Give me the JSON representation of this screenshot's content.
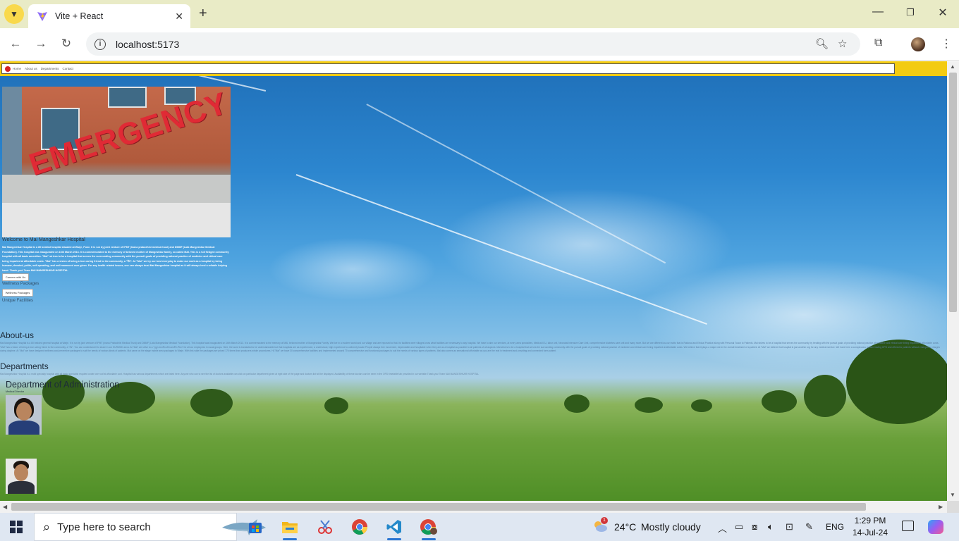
{
  "browser": {
    "tab_title": "Vite + React",
    "url": "localhost:5173",
    "icons": [
      "tab-menu-icon",
      "vite-icon",
      "close-icon",
      "plus-icon",
      "back-icon",
      "forward-icon",
      "reload-icon",
      "site-info-icon",
      "zoom-icon",
      "star-icon",
      "extensions-icon",
      "profile-icon",
      "kebab-menu-icon",
      "minimize-icon",
      "restore-icon",
      "window-close-icon"
    ]
  },
  "page": {
    "navbar": {
      "links": [
        "Home",
        "About us",
        "Departments",
        "Contact"
      ]
    },
    "hero": {
      "sign_text": "EMERGENCY"
    },
    "welcome_title": "Welcome to Mai Mangeshkar Hospital",
    "intro_text": "Mai Mangeshkar Hospital is a 80 bedded hospital situated at Warje, Pune. It is run by joint venture of IPMT (Inana prabodhini medical trust) and DMMF (Lata Mangeshkar Medical Foundation). This hospital was inaugurated on 16th March 2013. It is commemorated to the memory of beloved mother of Mangeshkar family, so called MAI. This is a full fledged community hospital with all basic amenities. \"Mai\" strives to be a hospital that serves the surrounding community with the pursuit goals of providing rational practice of medicine and ethical care being imparted at affordable costs. \"Mai\" has a vision of being a true caring friend to the community, a \"मैत्र\". At \"Mai\" we try our best everyday to make our work as a hospital by being humane, devoted, polite, soft-speaking, and well mannered user given. For any health related issues, one can always trust Mai Mangeshkar hospital as it will always lend a reliable helping hand. Thank you! Team MAI MANGESHKAR HOSPITAL",
    "careers_button": "Careers with Us",
    "wellness_label": "Wellness Packages",
    "wellness_button": "Wellness Packages",
    "facilities_label": "Unique Facilities",
    "about": {
      "heading": "About-us",
      "text": "Mai Mangeshkar Hospital is a 80 bedded general hospital at Warje. It is run by joint venture of IPMT (Inana Prabodhini Medical Trust) and DMMF (Lata Mangeshkar Medical Foundation). This hospital was inaugurated on 16th March 2013. It is commemorated to the memory of MAI, beloved mother of Mangeshkar Family. We live in a modern world and our village and are exposed to that. Its facilities were villages know what facilities are necessary to any hospital. We have to aim our services, at every area specialties, Medical ICU, labor unit, Neonatal Intensive Care Unit, comprehensive diabetes care unit and many more. But we are different as our motto that is Rational and Ethical Practice along with Personal Touch to Patients. Mai strives to be a hospital that serves the community by treating with the pursuit goals of providing rational practice of medicine and ethical care being imparted at affordable costs. \"Mai\" has a vision of being a true caring friend to the community, a \"मैत्र\". You can understand it to share in our SURMOD-seva. At \"Mai\" we strive to a \"मृदुल-आत्मीय-सौम्य-शालीन-नियत\" for all our employees in usual groups. Here, the word is translated to be understandable but that hospitals are as experienced, a understood, high experience to uniformly locate People always free movement, dependable and hospitable when they are as a hospital as possible to all patients of all aspects. Mai strives to be a hospital that serves the surrounding community with the pursuit goals of providing rational practice of medicine and ethical care being imparted at affordable costs. We believe that it plays a major role in the overall treatment of a patient. At \"Mai\" we believe that hospital is just another org for any medical service. We have here a conspicuous system having OPD and offered to patients without emergency charges during daytime. At \"Mai\" we have designed wellness and preventive packages to suit the needs of various kinds of patients. Mai came on the stage mobile area packages to Warje. With this wide the packages are priced 170 times than producers whole procedures. Hi-\"Mai\" we have 30 comprehensive facilities and implemented around 70 comprehensive and functional packages to suit the needs of various types of patients. Mai also comes as sensational affordable as you are the real in treatment and providing and connected form patient."
    },
    "departments": {
      "heading": "Departments",
      "text": "Mai Mangeshkar Hospital is a multi specialty hospital with all basic specialist required under one roof at affordable cost. Hospital has various departments which are listed here. Anyone who can to see the list of doctors available can click on particular department given at right side of the page and doctors list will be displayed. Availability of these doctors can be seen in the OPD timetable tab provided in our website.Thank you! Team MAI MANGESHKAR HOSPITAL",
      "admin_heading": "Department of Administration",
      "admin_subtitle": "Medical Director"
    }
  },
  "taskbar": {
    "search_placeholder": "Type here to search",
    "apps": [
      "microsoft-store-icon",
      "file-explorer-icon",
      "snipping-tool-icon",
      "chrome-icon",
      "vscode-icon",
      "chrome-profile-icon"
    ],
    "weather_badge": "1",
    "temperature": "24°C",
    "condition": "Mostly cloudy",
    "language": "ENG",
    "time": "1:29 PM",
    "date": "14-Jul-24"
  },
  "colors": {
    "tab_strip": "#e9ebc6",
    "nav_yellow": "#f3cb12",
    "emergency_red": "#e02a35",
    "taskbar": "#dfe7f2"
  }
}
